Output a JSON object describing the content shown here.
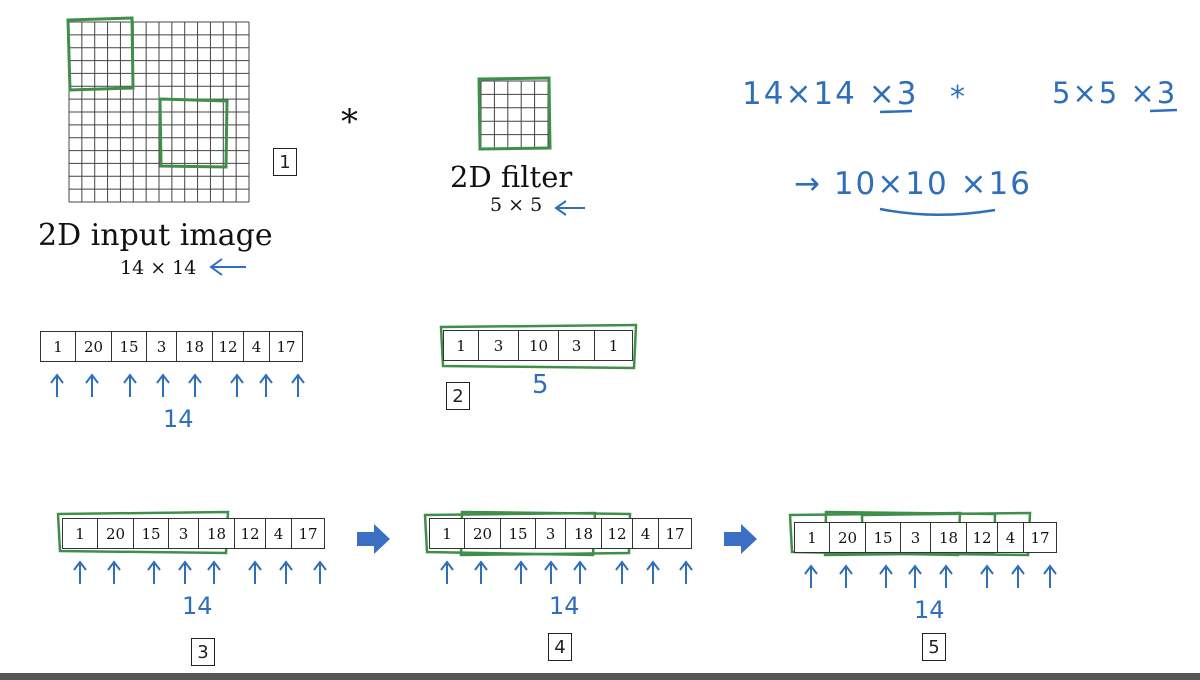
{
  "top": {
    "input_title": "2D input image",
    "input_size": "14 × 14",
    "operator": "*",
    "filter_title": "2D filter",
    "filter_size": "5 × 5",
    "marker_1": "1"
  },
  "notes": {
    "line1_left": "14×14 ×3",
    "line1_op": "*",
    "line1_right": "5×5 ×3",
    "line2": "→ 10×10 ×16"
  },
  "input_row": {
    "values": [
      "1",
      "20",
      "15",
      "3",
      "18",
      "12",
      "4",
      "17"
    ],
    "count_label": "14"
  },
  "filter_row": {
    "values": [
      "1",
      "3",
      "10",
      "3",
      "1"
    ],
    "count_label": "5",
    "marker": "2"
  },
  "steps": [
    {
      "marker": "3",
      "values": [
        "1",
        "20",
        "15",
        "3",
        "18",
        "12",
        "4",
        "17"
      ],
      "count_label": "14"
    },
    {
      "marker": "4",
      "values": [
        "1",
        "20",
        "15",
        "3",
        "18",
        "12",
        "4",
        "17"
      ],
      "count_label": "14"
    },
    {
      "marker": "5",
      "values": [
        "1",
        "20",
        "15",
        "3",
        "18",
        "12",
        "4",
        "17"
      ],
      "count_label": "14"
    }
  ],
  "colors": {
    "green": "#3f8f4a",
    "blue": "#2f6fba",
    "arrow": "#3b6fc4"
  }
}
